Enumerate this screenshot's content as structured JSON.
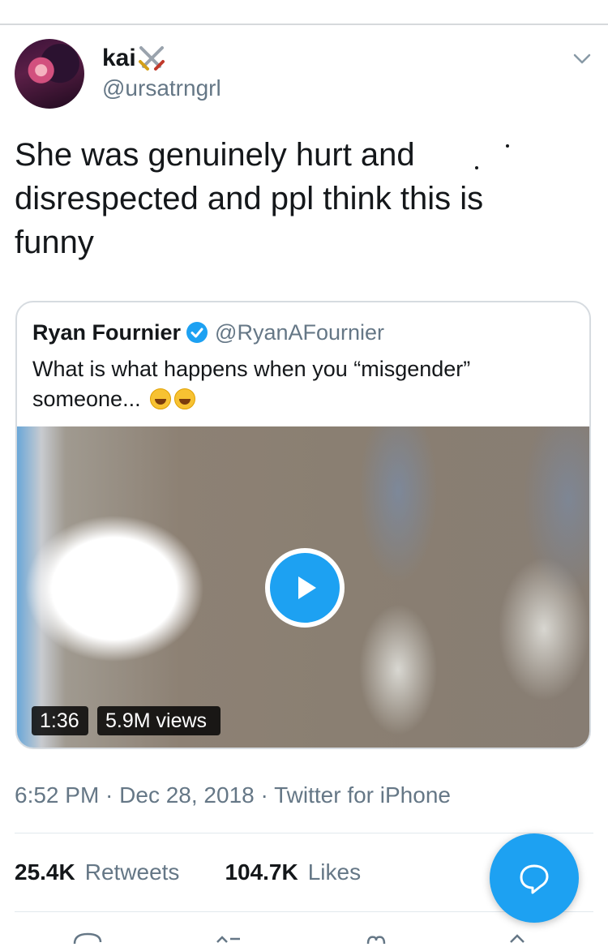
{
  "tweet": {
    "display_name": "kai",
    "handle": "@ursatrngrl",
    "text": "She was genuinely hurt and disrespected and ppl think this is funny",
    "timestamp": "6:52 PM · Dec 28, 2018 · Twitter for iPhone"
  },
  "quoted_tweet": {
    "name": "Ryan Fournier",
    "handle": "@RyanAFournier",
    "text": "What is what happens when you “misgender” someone...",
    "video": {
      "duration": "1:36",
      "views": "5.9M views"
    }
  },
  "stats": {
    "retweets_count": "25.4K",
    "retweets_label": "Retweets",
    "likes_count": "104.7K",
    "likes_label": "Likes"
  },
  "colors": {
    "accent": "#1da1f2",
    "secondary_text": "#657786",
    "primary_text": "#14171a"
  },
  "icons": [
    "crossed-swords-icon",
    "chevron-down-icon",
    "verified-badge-icon",
    "rofl-emoji-icon",
    "play-icon",
    "compose-reply-icon",
    "reply-icon",
    "retweet-icon",
    "like-icon",
    "share-icon"
  ]
}
